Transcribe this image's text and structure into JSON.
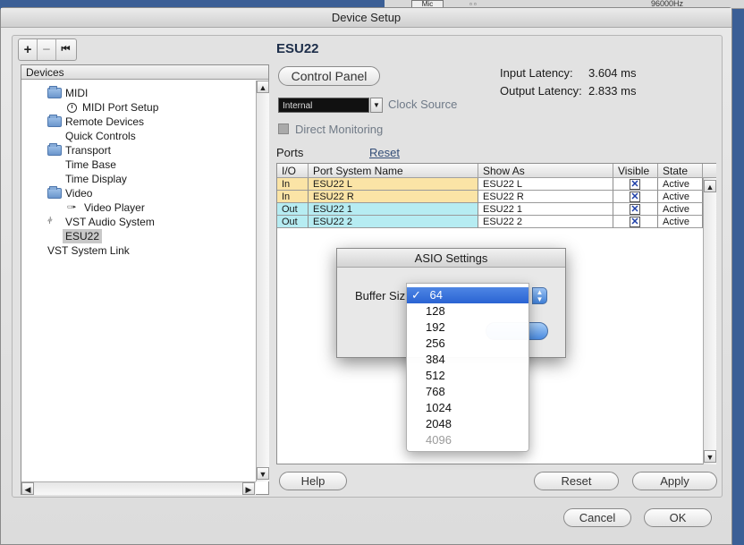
{
  "background": {
    "mic_label": "Mic",
    "sample_rate": "96000Hz"
  },
  "window": {
    "title": "Device Setup"
  },
  "toolbar": {
    "add": "+",
    "remove": "−",
    "reset": "⏮"
  },
  "devices": {
    "header": "Devices",
    "items": [
      {
        "label": "MIDI",
        "icon": "folder-icon"
      },
      {
        "label": "MIDI Port Setup",
        "icon": "clock-icon"
      },
      {
        "label": "Remote Devices",
        "icon": "folder-icon"
      },
      {
        "label": "Quick Controls",
        "icon": ""
      },
      {
        "label": "Transport",
        "icon": "folder-icon"
      },
      {
        "label": "Time Base",
        "icon": ""
      },
      {
        "label": "Time Display",
        "icon": ""
      },
      {
        "label": "Video",
        "icon": "folder-icon"
      },
      {
        "label": "Video Player",
        "icon": "video-icon"
      },
      {
        "label": "VST Audio System",
        "icon": "vst-icon"
      },
      {
        "label": "ESU22",
        "icon": ""
      },
      {
        "label": "VST System Link",
        "icon": ""
      }
    ]
  },
  "device": {
    "title": "ESU22",
    "control_panel": "Control Panel",
    "input_latency_label": "Input Latency:",
    "input_latency_value": "3.604 ms",
    "output_latency_label": "Output Latency:",
    "output_latency_value": "2.833 ms",
    "clock_value": "Internal",
    "clock_label": "Clock Source",
    "direct_monitoring": "Direct Monitoring"
  },
  "ports": {
    "label": "Ports",
    "reset": "Reset",
    "columns": [
      "I/O",
      "Port System Name",
      "Show As",
      "Visible",
      "State"
    ],
    "rows": [
      {
        "io": "In",
        "name": "ESU22 L",
        "show_as": "ESU22 L",
        "visible": "✕",
        "state": "Active",
        "color": "#fbe4a6"
      },
      {
        "io": "In",
        "name": "ESU22 R",
        "show_as": "ESU22 R",
        "visible": "✕",
        "state": "Active",
        "color": "#fbe4a6"
      },
      {
        "io": "Out",
        "name": "ESU22 1",
        "show_as": "ESU22 1",
        "visible": "✕",
        "state": "Active",
        "color": "#b6ecf2"
      },
      {
        "io": "Out",
        "name": "ESU22 2",
        "show_as": "ESU22 2",
        "visible": "✕",
        "state": "Active",
        "color": "#b6ecf2"
      }
    ]
  },
  "asio": {
    "title": "ASIO Settings",
    "buffer_label": "Buffer Siz",
    "selected": "64",
    "check": "✓",
    "options": [
      "64",
      "128",
      "192",
      "256",
      "384",
      "512",
      "768",
      "1024",
      "2048",
      "4096"
    ]
  },
  "buttons": {
    "help": "Help",
    "reset": "Reset",
    "apply": "Apply",
    "cancel": "Cancel",
    "ok": "OK"
  },
  "arrows": {
    "up": "▲",
    "down": "▼",
    "left": "◀",
    "right": "▶",
    "select": "⌄"
  }
}
